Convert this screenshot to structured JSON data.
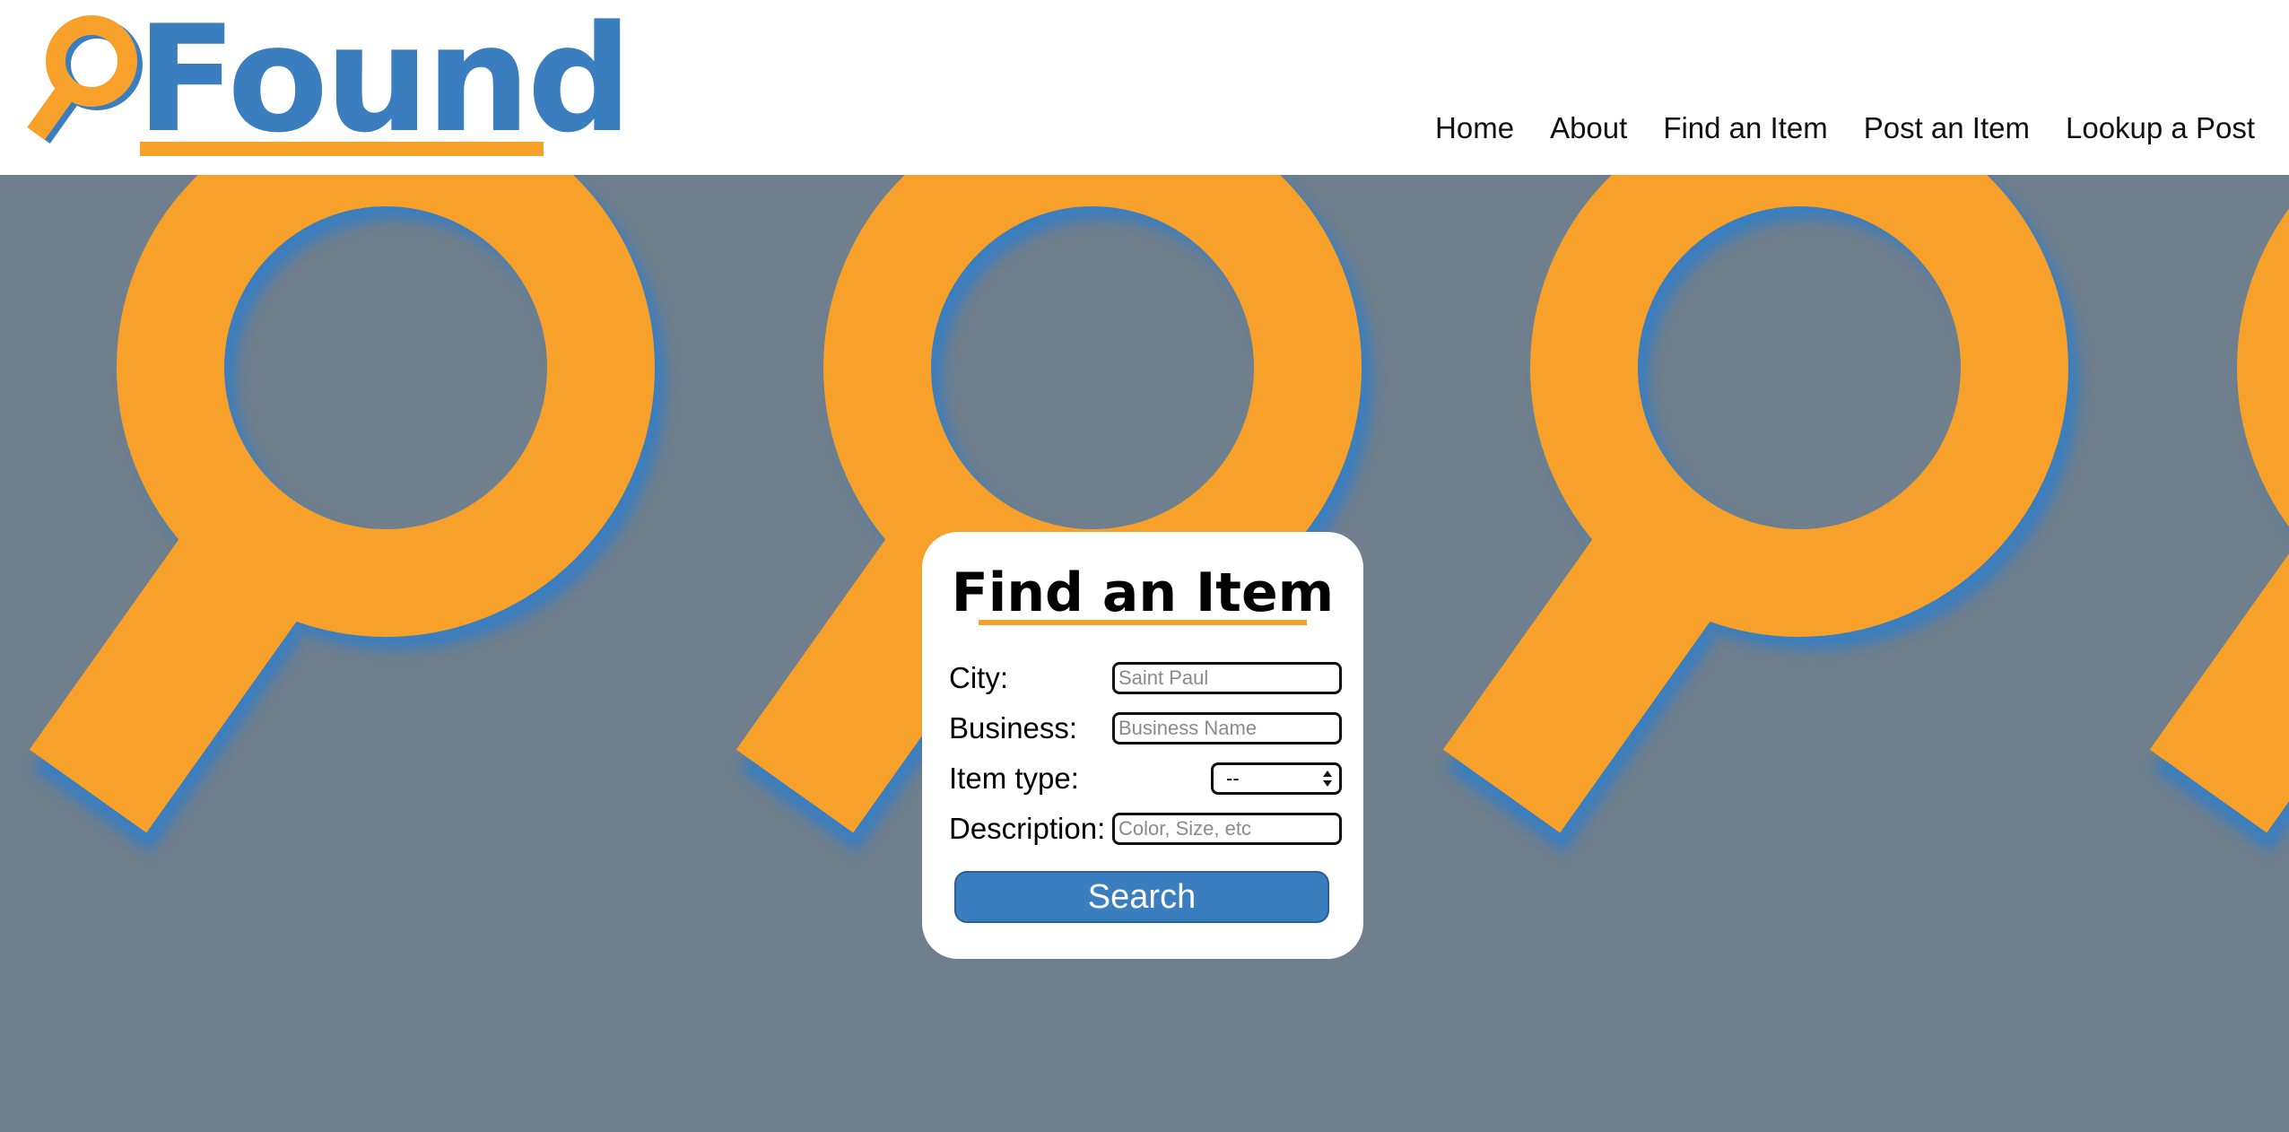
{
  "brand": {
    "name": "Found",
    "primary_color": "#3a7ebf",
    "accent_color": "#f7a12b",
    "hero_background_color": "#6f7f8d",
    "logo_icon": "magnifying-glass-icon"
  },
  "nav": {
    "items": [
      {
        "label": "Home"
      },
      {
        "label": "About"
      },
      {
        "label": "Find an Item"
      },
      {
        "label": "Post an Item"
      },
      {
        "label": "Lookup a Post"
      }
    ]
  },
  "find_form": {
    "title": "Find an Item",
    "city": {
      "label": "City:",
      "value": "",
      "placeholder": "Saint Paul"
    },
    "business": {
      "label": "Business:",
      "value": "",
      "placeholder": "Business Name"
    },
    "item_type": {
      "label": "Item type:",
      "selected": "--"
    },
    "description": {
      "label": "Description:",
      "value": "",
      "placeholder": "Color, Size, etc"
    },
    "search_label": "Search"
  }
}
